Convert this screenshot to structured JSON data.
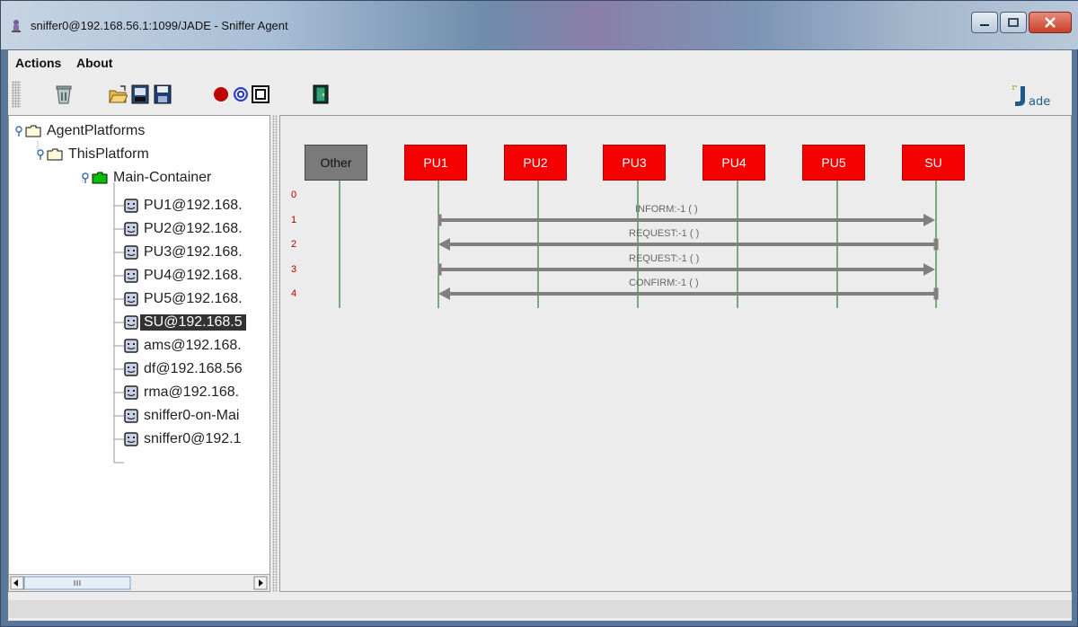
{
  "window": {
    "title": "sniffer0@192.168.56.1:1099/JADE - Sniffer Agent"
  },
  "menu": {
    "items": [
      "Actions",
      "About"
    ]
  },
  "toolbar": {
    "buttons": [
      "clear-canvas-icon",
      "open-folder-icon",
      "snapshot-icon",
      "save-icon",
      "record-icon",
      "sniff-icon",
      "list-icon",
      "exit-door-icon"
    ],
    "logo": "jade-logo"
  },
  "tree": {
    "root": "AgentPlatforms",
    "platform": "ThisPlatform",
    "container": "Main-Container",
    "agents": [
      "PU1@192.168.",
      "PU2@192.168.",
      "PU3@192.168.",
      "PU4@192.168.",
      "PU5@192.168.",
      "SU@192.168.5",
      "ams@192.168.",
      "df@192.168.56",
      "rma@192.168.",
      "sniffer0-on-Mai",
      "sniffer0@192.1"
    ],
    "selected_agent": "SU@192.168.5"
  },
  "sniffer": {
    "agents": [
      "Other",
      "PU1",
      "PU2",
      "PU3",
      "PU4",
      "PU5",
      "SU"
    ],
    "message_indices": [
      "0",
      "1",
      "2",
      "3",
      "4"
    ],
    "messages": [
      {
        "label": "INFORM:-1 (        )",
        "from": "PU1",
        "to": "SU"
      },
      {
        "label": "REQUEST:-1 (        )",
        "from": "SU",
        "to": "PU1"
      },
      {
        "label": "REQUEST:-1 (        )",
        "from": "PU1",
        "to": "SU"
      },
      {
        "label": "CONFIRM:-1 (        )",
        "from": "SU",
        "to": "PU1"
      }
    ]
  },
  "colors": {
    "agent_box": "#f50000",
    "other_box": "#7a7a7a",
    "lifeline": "#2e7d32",
    "arrow": "#808080",
    "index": "#b00000"
  }
}
